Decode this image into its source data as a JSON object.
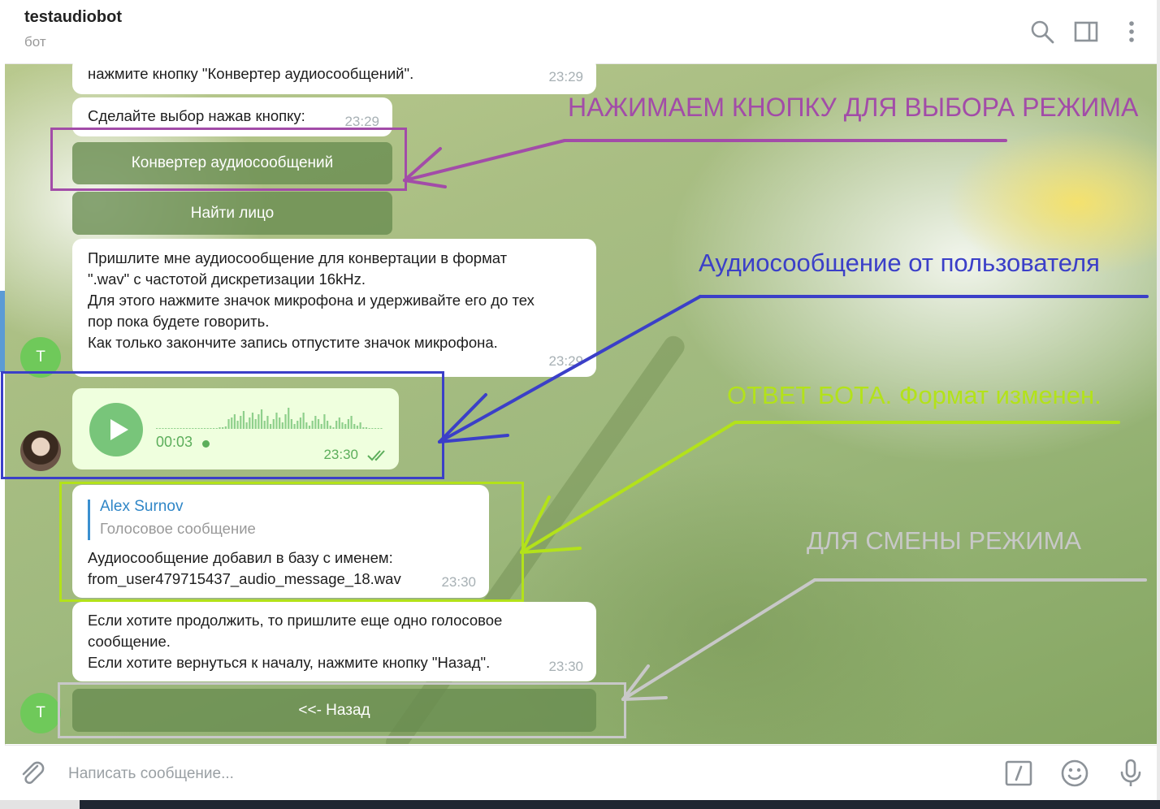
{
  "header": {
    "title": "testaudiobot",
    "subtitle": "бот",
    "icons": [
      "search-icon",
      "sidebar-toggle-icon",
      "more-options-icon"
    ]
  },
  "messages": {
    "m1": {
      "lines": [
        "нажмите кнопку \"Конвертер аудиосообщений\"."
      ],
      "time": "23:29"
    },
    "m2": {
      "lines": [
        "Сделайте выбор нажав кнопку:"
      ],
      "time": "23:29"
    },
    "keyboard1": [
      "Конвертер аудиосообщений",
      "Найти лицо"
    ],
    "m3": {
      "lines": [
        "Пришлите мне аудиосообщение для конвертации в формат",
        "\".wav\" с частотой дискретизации 16kHz.",
        "Для этого нажмите значок микрофона и удерживайте его до тех",
        "пор пока будете говорить.",
        "Как только закончите запись отпустите значок микрофона."
      ],
      "time": "23:29"
    },
    "voice": {
      "duration": "00:03",
      "time": "23:30",
      "status": "read"
    },
    "m4": {
      "reply_name": "Alex Surnov",
      "reply_text": "Голосовое сообщение",
      "lines": [
        "Аудиосообщение добавил в базу с именем:",
        "from_user479715437_audio_message_18.wav"
      ],
      "time": "23:30"
    },
    "m5": {
      "lines": [
        "Если хотите продолжить, то пришлите еще одно голосовое",
        "сообщение.",
        "Если хотите вернуться к началу, нажмите кнопку \"Назад\"."
      ],
      "time": "23:30"
    },
    "keyboard2": [
      "<<- Назад"
    ]
  },
  "avatars": {
    "bot_initial": "T"
  },
  "annotations": {
    "mode_select": {
      "text": "НАЖИМАЕМ КНОПКУ ДЛЯ ВЫБОРА РЕЖИМА",
      "color": "#a24ca8"
    },
    "user_audio": {
      "text": "Аудиосообщение от пользователя",
      "color": "#3b3fc8"
    },
    "bot_reply": {
      "text": "ОТВЕТ БОТА. Формат изменен.",
      "color": "#b3e21a"
    },
    "mode_change": {
      "text": "ДЛЯ СМЕНЫ РЕЖИМА",
      "color": "#c8c8c8"
    }
  },
  "input": {
    "placeholder": "Написать сообщение...",
    "icons": [
      "attach-icon",
      "bot-commands-icon",
      "emoji-icon",
      "microphone-icon"
    ]
  },
  "colors": {
    "keyboard_button": "#688c50",
    "voice_bubble": "#efffde",
    "voice_accent": "#78c57a",
    "reply_name": "#2f86c7",
    "bot_avatar": "#6fc95a"
  }
}
